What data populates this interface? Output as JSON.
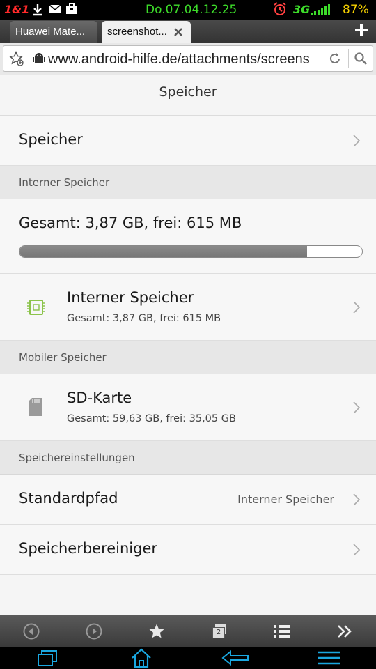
{
  "status_bar": {
    "carrier": "1&1",
    "datetime": "Do.07.04.12.25",
    "network": "3G",
    "battery": "87%"
  },
  "browser": {
    "tabs": [
      {
        "label": "Huawei Mate..."
      },
      {
        "label": "screenshot..."
      }
    ],
    "url": "www.android-hilfe.de/attachments/screens"
  },
  "page": {
    "title": "Speicher",
    "row_speicher": "Speicher",
    "section_internal": "Interner Speicher",
    "total_label": "Gesamt: 3,87 GB, frei: 615 MB",
    "usage_fraction": 0.84,
    "internal_item": {
      "title": "Interner Speicher",
      "subtitle": "Gesamt: 3,87 GB, frei: 615 MB"
    },
    "section_mobile": "Mobiler Speicher",
    "sd_item": {
      "title": "SD-Karte",
      "subtitle": "Gesamt: 59,63 GB, frei: 35,05 GB"
    },
    "section_settings": "Speichereinstellungen",
    "default_path": {
      "label": "Standardpfad",
      "value": "Interner Speicher"
    },
    "cleaner": "Speicherbereiniger"
  },
  "toolbar": {
    "tab_count": "2"
  },
  "colors": {
    "clock": "#3ddc2a",
    "signal": "#3ddc2a",
    "battery": "#f5d000",
    "carrier": "#ff2a2a",
    "nav_blue": "#1aa7e0",
    "alarm": "#ff4040"
  }
}
